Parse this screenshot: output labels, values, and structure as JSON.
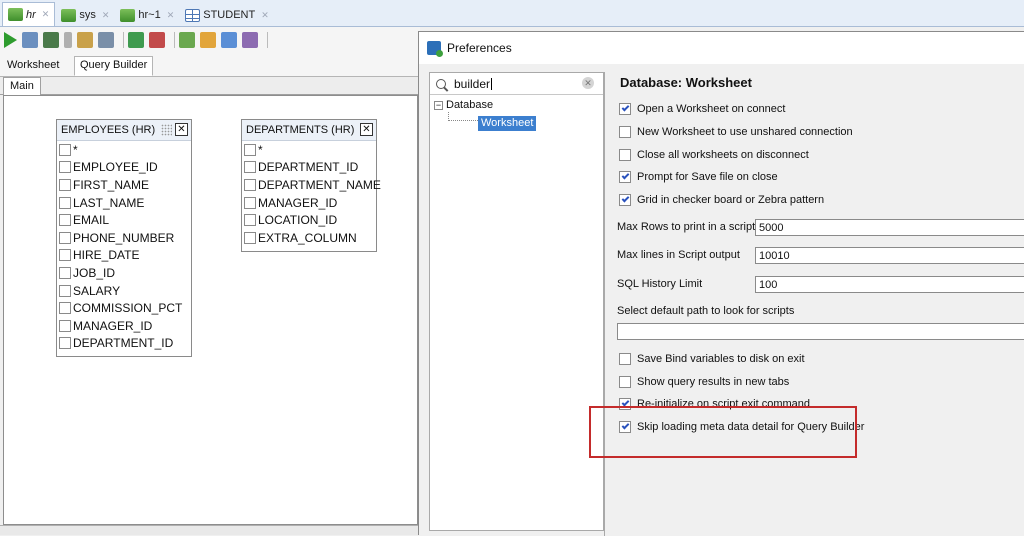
{
  "tabs": [
    {
      "label": "hr",
      "icon": "sql-connection-icon",
      "active": true
    },
    {
      "label": "sys",
      "icon": "sql-connection-icon",
      "active": false
    },
    {
      "label": "hr~1",
      "icon": "sql-connection-icon",
      "active": false
    },
    {
      "label": "STUDENT",
      "icon": "table-icon",
      "active": false
    }
  ],
  "worksheet_tabs": {
    "worksheet": "Worksheet",
    "query_builder": "Query Builder"
  },
  "subtab": "Main",
  "qb_tables": [
    {
      "title": "EMPLOYEES (HR)",
      "columns": [
        "*",
        "EMPLOYEE_ID",
        "FIRST_NAME",
        "LAST_NAME",
        "EMAIL",
        "PHONE_NUMBER",
        "HIRE_DATE",
        "JOB_ID",
        "SALARY",
        "COMMISSION_PCT",
        "MANAGER_ID",
        "DEPARTMENT_ID"
      ]
    },
    {
      "title": "DEPARTMENTS (HR)",
      "columns": [
        "*",
        "DEPARTMENT_ID",
        "DEPARTMENT_NAME",
        "MANAGER_ID",
        "LOCATION_ID",
        "EXTRA_COLUMN"
      ]
    }
  ],
  "dialog": {
    "title": "Preferences",
    "search": {
      "value": "builder"
    },
    "tree": {
      "root": "Database",
      "child": "Worksheet"
    },
    "section_title": "Database: Worksheet",
    "options_top": [
      {
        "label": "Open a Worksheet on connect",
        "checked": true
      },
      {
        "label": "New Worksheet to use unshared connection",
        "checked": false
      },
      {
        "label": "Close all worksheets on disconnect",
        "checked": false
      },
      {
        "label": "Prompt for Save file on close",
        "checked": true
      },
      {
        "label": "Grid in checker board or Zebra pattern",
        "checked": true
      }
    ],
    "fields": [
      {
        "label": "Max Rows to print in a script",
        "value": "5000"
      },
      {
        "label": "Max lines in Script output",
        "value": "10010"
      },
      {
        "label": "SQL History Limit",
        "value": "100"
      }
    ],
    "default_path_label": "Select default path to look for scripts",
    "default_path_value": "",
    "options_bottom": [
      {
        "label": "Save Bind variables to disk on exit",
        "checked": false
      },
      {
        "label": "Show query results in new tabs",
        "checked": false
      },
      {
        "label": "Re-initialize on script exit command",
        "checked": true
      },
      {
        "label": "Skip loading meta data detail for Query Builder",
        "checked": true
      }
    ]
  },
  "colors": {
    "highlight_border": "#c42b2b",
    "selection": "#3c7fcf",
    "check": "#2a52be"
  }
}
